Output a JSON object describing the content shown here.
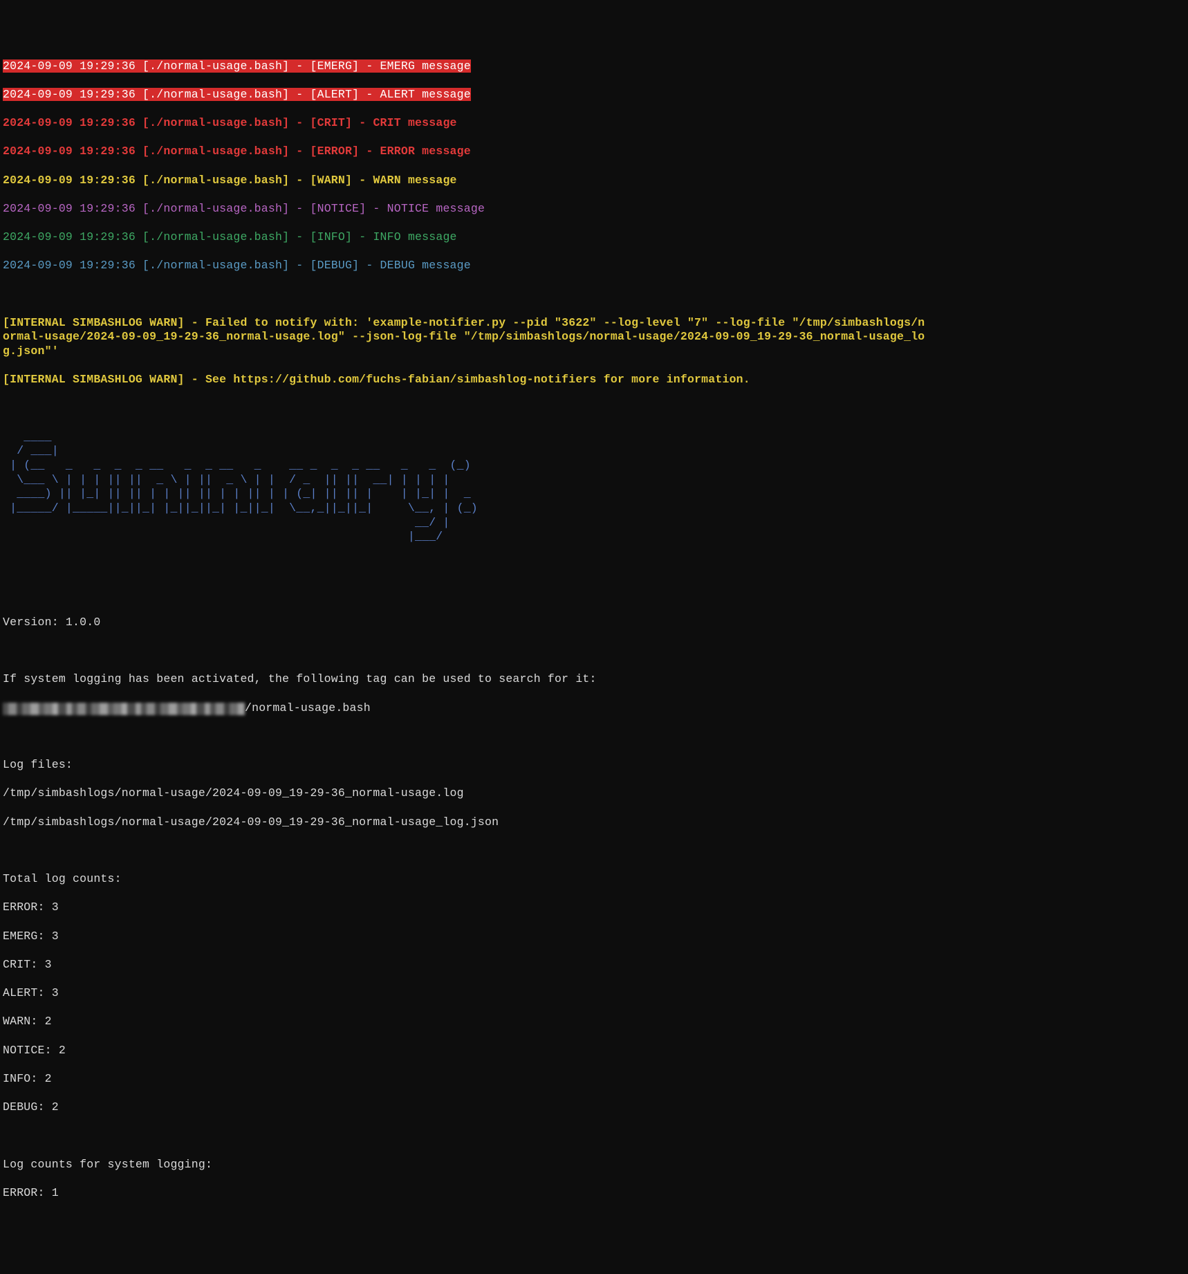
{
  "logs": [
    {
      "level": "EMERG",
      "ts": "2024-09-09 19:29:36",
      "src": "[./normal-usage.bash]",
      "tag": "[EMERG]",
      "msg": "EMERG message",
      "style": "white-on-red"
    },
    {
      "level": "ALERT",
      "ts": "2024-09-09 19:29:36",
      "src": "[./normal-usage.bash]",
      "tag": "[ALERT]",
      "msg": "ALERT message",
      "style": "white-on-red"
    },
    {
      "level": "CRIT",
      "ts": "2024-09-09 19:29:36",
      "src": "[./normal-usage.bash]",
      "tag": "[CRIT]",
      "msg": "CRIT message",
      "style": "red-bold"
    },
    {
      "level": "ERROR",
      "ts": "2024-09-09 19:29:36",
      "src": "[./normal-usage.bash]",
      "tag": "[ERROR]",
      "msg": "ERROR message",
      "style": "red-bold"
    },
    {
      "level": "WARN",
      "ts": "2024-09-09 19:29:36",
      "src": "[./normal-usage.bash]",
      "tag": "[WARN]",
      "msg": "WARN message",
      "style": "yellow-bold"
    },
    {
      "level": "NOTICE",
      "ts": "2024-09-09 19:29:36",
      "src": "[./normal-usage.bash]",
      "tag": "[NOTICE]",
      "msg": "NOTICE message",
      "style": "magenta"
    },
    {
      "level": "INFO",
      "ts": "2024-09-09 19:29:36",
      "src": "[./normal-usage.bash]",
      "tag": "[INFO]",
      "msg": "INFO message",
      "style": "green"
    },
    {
      "level": "DEBUG",
      "ts": "2024-09-09 19:29:36",
      "src": "[./normal-usage.bash]",
      "tag": "[DEBUG]",
      "msg": "DEBUG message",
      "style": "cyan"
    }
  ],
  "warn1": "[INTERNAL SIMBASHLOG WARN] - Failed to notify with: 'example-notifier.py --pid \"3622\" --log-level \"7\" --log-file \"/tmp/simbashlogs/normal-usage/2024-09-09_19-29-36_normal-usage.log\" --json-log-file \"/tmp/simbashlogs/normal-usage/2024-09-09_19-29-36_normal-usage_log.json\"'",
  "warn2": "[INTERNAL SIMBASHLOG WARN] - See https://github.com/fuchs-fabian/simbashlog-notifiers for more information.",
  "ascii_art": "   ____                                                 \n  / ___|                                                \n | (__   _   _  _  _ __   _  _ __   _    __ _  _  _ __   _   _  (_)\n  \\___ \\ | | | || ||  _ \\ | ||  _ \\ | |  / _  || ||  __| | | | |    \n  ____) || |_| || || | | || || | | || | | (_| || || |    | |_| |  _ \n |_____/ |_____||_||_| |_||_||_| |_||_|  \\__,_||_||_|     \\__, | (_)\n                                                           __/ |    \n                                                          |___/     ",
  "summary": {
    "version_label": "Version: 1.0.0",
    "syslog_intro": "If system logging has been activated, the following tag can be used to search for it:",
    "syslog_tag_suffix": "/normal-usage.bash",
    "log_files_header": "Log files:",
    "log_file_1": "/tmp/simbashlogs/normal-usage/2024-09-09_19-29-36_normal-usage.log",
    "log_file_2": "/tmp/simbashlogs/normal-usage/2024-09-09_19-29-36_normal-usage_log.json",
    "total_counts_header": "Total log counts:",
    "total_counts": [
      "ERROR: 3",
      "EMERG: 3",
      "CRIT: 3",
      "ALERT: 3",
      "WARN: 2",
      "NOTICE: 2",
      "INFO: 2",
      "DEBUG: 2"
    ],
    "syslog_counts_header": "Log counts for system logging:",
    "syslog_counts": [
      "ERROR: 1"
    ]
  }
}
